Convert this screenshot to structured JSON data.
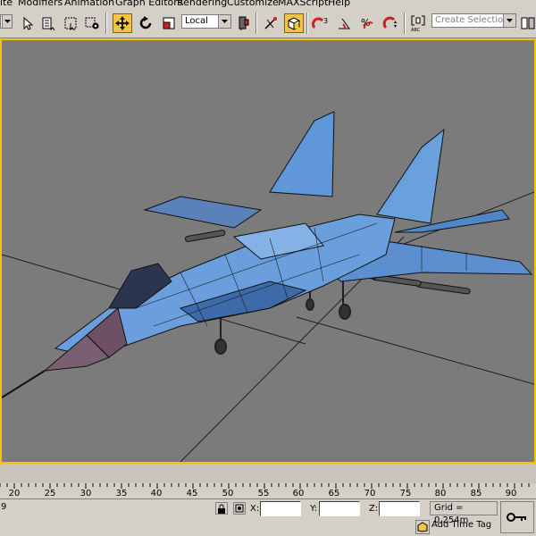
{
  "menu": {
    "items": [
      "ite",
      "Modifiers",
      "Animation",
      "Graph Editors",
      "Rendering",
      "Customize",
      "MAXScript",
      "Help"
    ]
  },
  "toolbar": {
    "reference_coord": "Local",
    "selection_set_placeholder": "Create Selection Set",
    "snap_label": "3",
    "icons": [
      "select-icon",
      "select-by-name-icon",
      "rect-region-icon",
      "window-crossing-icon",
      "move-icon",
      "rotate-icon",
      "scale-icon",
      "ref-coord-dropdown",
      "pivot-icon",
      "manipulate-icon",
      "keyboard-shortcut-icon",
      "snap-3d-icon",
      "angle-snap-icon",
      "percent-snap-icon",
      "spinner-snap-icon",
      "edit-named-selections-icon",
      "mirror-icon",
      "align-icon"
    ]
  },
  "timeline": {
    "ticks": [
      "20",
      "25",
      "30",
      "35",
      "40",
      "45",
      "50",
      "55",
      "60",
      "65",
      "70",
      "75",
      "80",
      "85",
      "90"
    ]
  },
  "status": {
    "left_text": "9",
    "x_label": "X:",
    "y_label": "Y:",
    "z_label": "Z:",
    "x_value": "",
    "y_value": "",
    "z_value": "",
    "grid": "Grid = 0.254m",
    "add_time_tag": "Add Time Tag"
  },
  "colors": {
    "viewport_bg": "#7b7b7b",
    "active_border": "#f5c400",
    "aircraft_blue": "#5b8fd0"
  }
}
